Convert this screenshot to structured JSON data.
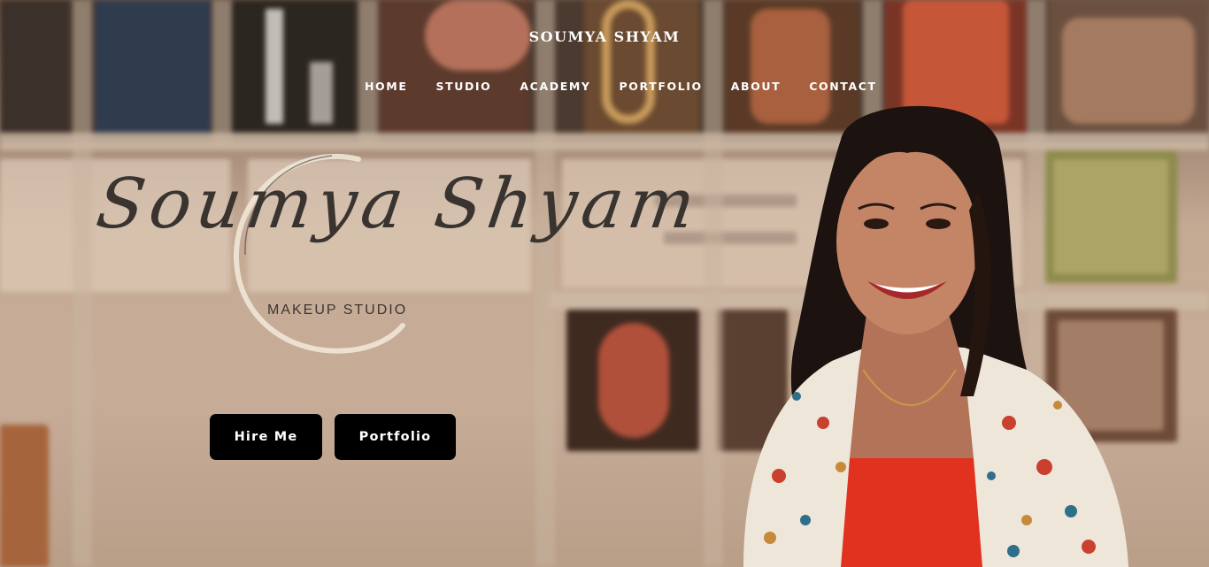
{
  "header": {
    "brand": "SOUMYA SHYAM"
  },
  "nav": {
    "items": [
      {
        "label": "HOME"
      },
      {
        "label": "STUDIO"
      },
      {
        "label": "ACADEMY"
      },
      {
        "label": "PORTFOLIO"
      },
      {
        "label": "ABOUT"
      },
      {
        "label": "CONTACT"
      }
    ]
  },
  "logo": {
    "script": "Soumya Shyam",
    "subtitle": "MAKEUP STUDIO"
  },
  "buttons": {
    "hire": "Hire Me",
    "portfolio": "Portfolio"
  },
  "colors": {
    "button_bg": "#000000",
    "button_text": "#ffffff",
    "nav_text": "#ffffff",
    "logo_ink": "#3a3431"
  }
}
